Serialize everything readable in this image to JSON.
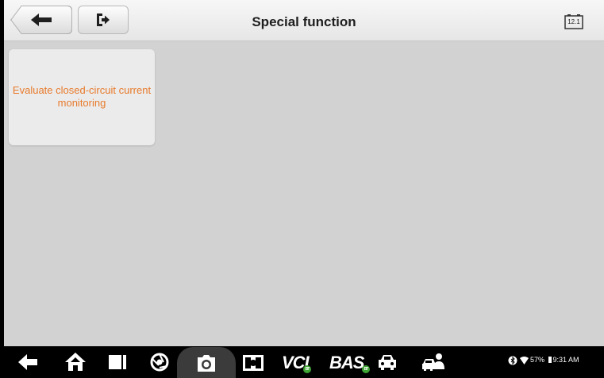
{
  "header": {
    "title": "Special function",
    "battery_voltage": "12.1"
  },
  "main": {
    "tiles": [
      {
        "label": "Evaluate closed-circuit current monitoring"
      }
    ]
  },
  "navbar": {
    "vci_label": "VCI",
    "bas_label": "BAS",
    "bt_badge": "BT",
    "status": {
      "battery_percent": "57%",
      "time": "9:31 AM"
    }
  }
}
